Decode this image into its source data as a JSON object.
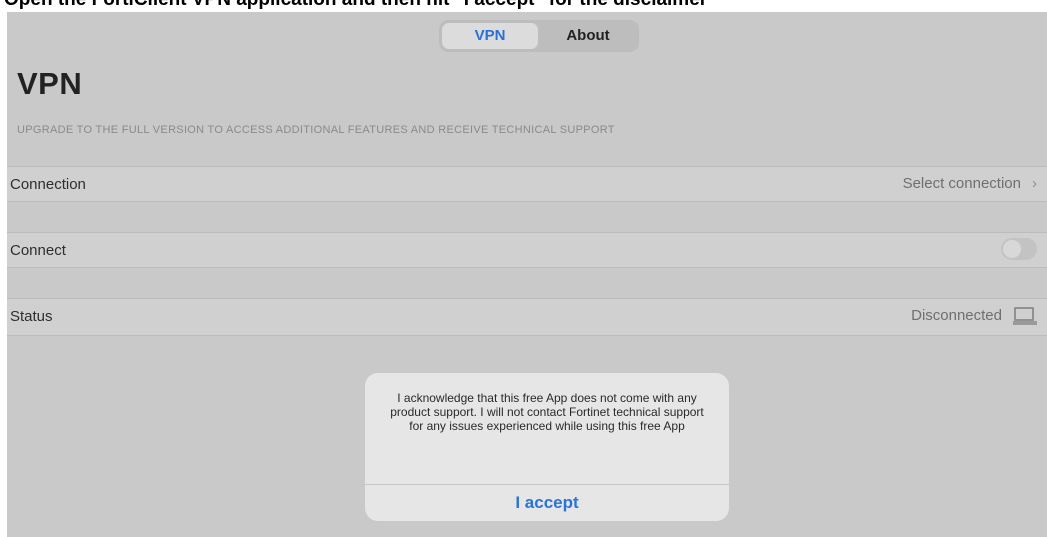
{
  "caption": "Open the FortiClient VPN application and then hit \"I accept\" for the disclaimer",
  "tabs": [
    {
      "label": "VPN",
      "selected": true
    },
    {
      "label": "About",
      "selected": false
    }
  ],
  "page_title": "VPN",
  "upgrade_note": "UPGRADE TO THE FULL VERSION TO ACCESS ADDITIONAL FEATURES AND RECEIVE TECHNICAL SUPPORT",
  "rows": {
    "connection": {
      "label": "Connection",
      "value": "Select connection"
    },
    "connect": {
      "label": "Connect",
      "toggle_on": false
    },
    "status": {
      "label": "Status",
      "value": "Disconnected"
    }
  },
  "icons": {
    "chevron": "chevron-right-icon",
    "status": "computer-icon"
  },
  "dialog": {
    "message": "I acknowledge that this free App does not come with any product support. I will not contact Fortinet technical support for any issues experienced while using this free App",
    "button_label": "I accept"
  },
  "colors": {
    "accent": "#2a73d9",
    "screen_background": "#c9c9c9",
    "dialog_background": "#e6e6e6"
  }
}
